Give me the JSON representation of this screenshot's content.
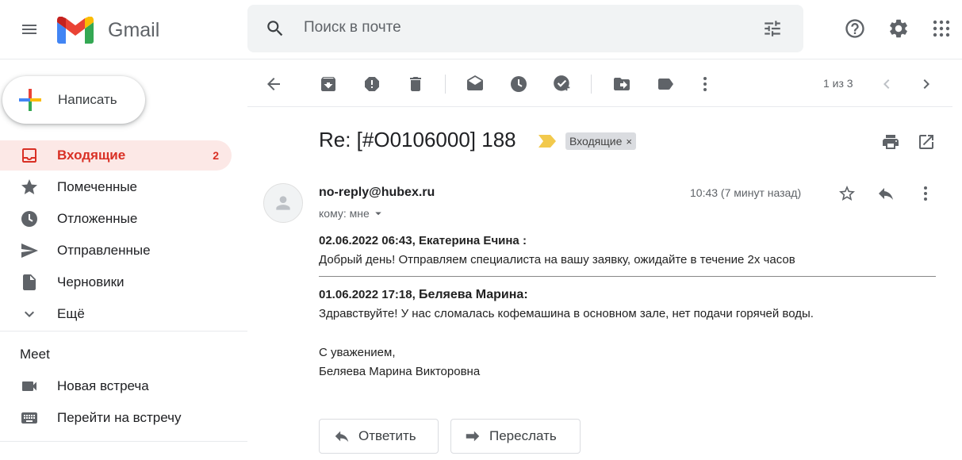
{
  "app": {
    "name": "Gmail"
  },
  "search": {
    "placeholder": "Поиск в почте"
  },
  "sidebar": {
    "compose_label": "Написать",
    "items": [
      {
        "label": "Входящие",
        "count": "2",
        "active": true
      },
      {
        "label": "Помеченные"
      },
      {
        "label": "Отложенные"
      },
      {
        "label": "Отправленные"
      },
      {
        "label": "Черновики"
      },
      {
        "label": "Ещё"
      }
    ],
    "meet": {
      "title": "Meet",
      "items": [
        {
          "label": "Новая встреча"
        },
        {
          "label": "Перейти на встречу"
        }
      ]
    }
  },
  "toolbar": {
    "pager": "1 из 3"
  },
  "message": {
    "subject": "Re: [#O0106000] 188",
    "label_chip": "Входящие",
    "label_chip_close": "×",
    "sender": "no-reply@hubex.ru",
    "to_line": "кому: мне",
    "time": "10:43 (7 минут назад)",
    "entries": [
      {
        "header": "02.06.2022 06:43, Екатерина Ечина :",
        "text": "Добрый день! Отправляем специалиста на вашу заявку, ожидайте в течение 2х часов"
      },
      {
        "header_date": "01.06.2022 17:18, ",
        "header_name": "Беляева Марина:",
        "text": "Здравствуйте! У нас сломалась кофемашина в основном зале, нет подачи горячей воды."
      }
    ],
    "signature": [
      "С уважением,",
      "Беляева Марина Викторовна"
    ],
    "reply_label": "Ответить",
    "forward_label": "Переслать"
  },
  "colors": {
    "accent_red": "#d93025",
    "active_bg": "#fce8e6",
    "important_marker": "#f2c94c"
  }
}
